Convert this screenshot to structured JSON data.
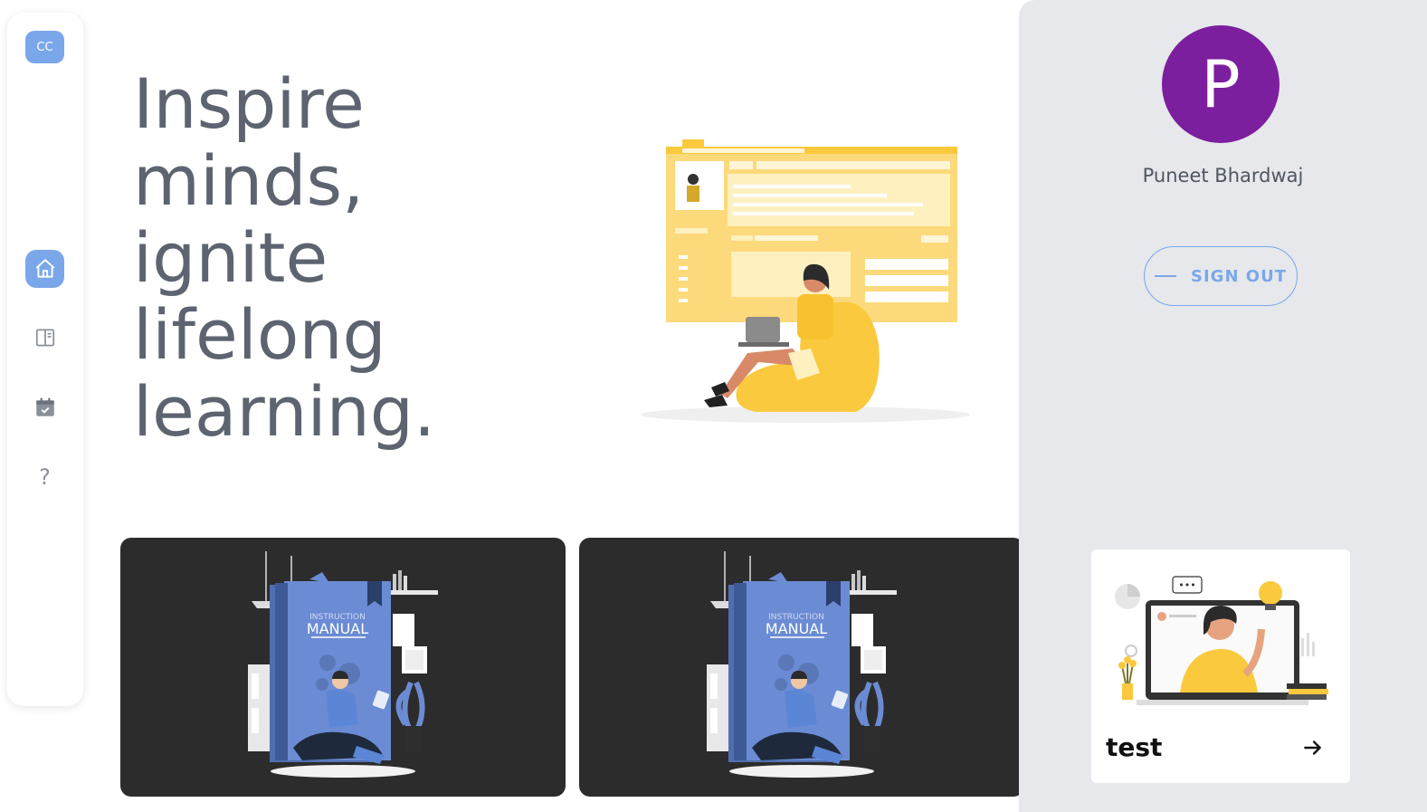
{
  "sidebar": {
    "logo_text": "CC",
    "items": [
      {
        "name": "home",
        "icon": "home-icon"
      },
      {
        "name": "courses",
        "icon": "book-icon"
      },
      {
        "name": "calendar",
        "icon": "calendar-check-icon"
      },
      {
        "name": "help",
        "icon": "question-icon",
        "label": "?"
      }
    ]
  },
  "hero": {
    "lines": [
      "Inspire",
      "minds,",
      "ignite",
      "lifelong",
      "learning."
    ]
  },
  "cards": [
    {
      "cover_top": "INSTRUCTION",
      "cover_main": "MANUAL"
    },
    {
      "cover_top": "INSTRUCTION",
      "cover_main": "MANUAL"
    }
  ],
  "profile": {
    "avatar_letter": "P",
    "name": "Puneet Bhardwaj",
    "signout_label": "SIGN OUT"
  },
  "mini_card": {
    "title": "test",
    "dots": "•••"
  },
  "colors": {
    "accent": "#7aa7ea",
    "avatar_bg": "#7c1f9e",
    "hero_text": "#5d6470",
    "card_bg": "#2c2c2c",
    "panel_bg": "#e6e8ec",
    "illustration_yellow": "#fbc93d",
    "book_blue": "#4f6fb0"
  }
}
